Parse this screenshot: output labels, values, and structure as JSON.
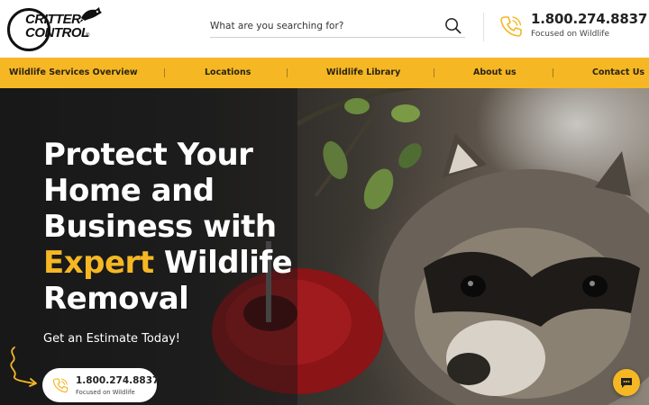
{
  "brand": {
    "logo_line1": "CRITTER",
    "logo_line2": "CONTROL",
    "logo_reg": "®"
  },
  "search": {
    "placeholder": "What are you searching for?",
    "icon": "search-icon"
  },
  "contact": {
    "phone": "1.800.274.8837",
    "tagline": "Focused on Wildlife",
    "icon": "phone-icon"
  },
  "nav": {
    "items": [
      {
        "label": "Wildlife Services Overview"
      },
      {
        "label": "Locations"
      },
      {
        "label": "Wildlife Library"
      },
      {
        "label": "About us"
      },
      {
        "label": "Contact Us"
      }
    ]
  },
  "hero": {
    "title_line1": "Protect Your",
    "title_line2": "Home and",
    "title_line3": "Business with",
    "title_accent": "Expert",
    "title_line4_rest": " Wildlife",
    "title_line5": "Removal",
    "subtitle": "Get an Estimate Today!",
    "cta_phone": "1.800.274.8837",
    "cta_tagline": "Focused on Wildlife"
  },
  "chat": {
    "icon": "chat-bubble-icon"
  },
  "colors": {
    "accent": "#f5b724",
    "dark": "#222222",
    "white": "#ffffff"
  }
}
